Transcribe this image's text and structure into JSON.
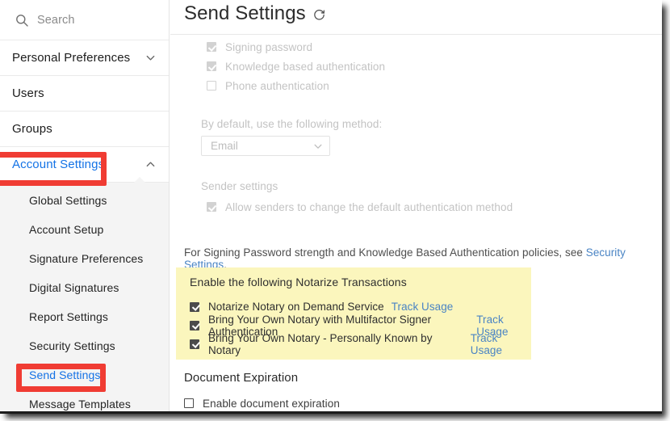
{
  "window": {
    "accent_blue": "#1473e6",
    "link_blue": "#4a84c4",
    "highlight_yellow": "#fbf6bd",
    "annotation_red": "#f03c33"
  },
  "sidebar": {
    "search": {
      "placeholder": "Search",
      "icon": "search-icon"
    },
    "nav": [
      {
        "label": "Personal Preferences",
        "icon": "chevron-down-icon",
        "expanded": false,
        "selected": false
      },
      {
        "label": "Users",
        "icon": "",
        "expanded": false,
        "selected": false
      },
      {
        "label": "Groups",
        "icon": "",
        "expanded": false,
        "selected": false
      },
      {
        "label": "Account Settings",
        "icon": "chevron-up-icon",
        "expanded": true,
        "selected": true
      }
    ],
    "submenu": [
      {
        "label": "Global Settings",
        "active": false
      },
      {
        "label": "Account Setup",
        "active": false
      },
      {
        "label": "Signature Preferences",
        "active": false
      },
      {
        "label": "Digital Signatures",
        "active": false
      },
      {
        "label": "Report Settings",
        "active": false
      },
      {
        "label": "Security Settings",
        "active": false
      },
      {
        "label": "Send Settings",
        "active": true
      },
      {
        "label": "Message Templates",
        "active": false
      }
    ]
  },
  "main": {
    "title": "Send Settings",
    "title_icon": "refresh-icon",
    "auth_methods": [
      {
        "label": "Signing password",
        "checked": true,
        "disabled": true
      },
      {
        "label": "Knowledge based authentication",
        "checked": true,
        "disabled": true
      },
      {
        "label": "Phone authentication",
        "checked": false,
        "disabled": true
      }
    ],
    "default_method": {
      "label": "By default, use the following method:",
      "value": "Email"
    },
    "sender_settings": {
      "label": "Sender settings",
      "option": {
        "label": "Allow senders to change the default authentication method",
        "checked": true,
        "disabled": true
      }
    },
    "policy_note": {
      "text": "For Signing Password strength and Knowledge Based Authentication policies, see ",
      "link": "Security Settings",
      "suffix": "."
    },
    "notarize": {
      "title": "Enable the following Notarize Transactions",
      "items": [
        {
          "label": "Notarize Notary on Demand Service",
          "checked": true,
          "link": "Track Usage"
        },
        {
          "label": "Bring Your Own Notary with Multifactor Signer Authentication",
          "checked": true,
          "link": "Track Usage"
        },
        {
          "label": "Bring Your Own Notary - Personally Known by Notary",
          "checked": true,
          "link": "Track Usage"
        }
      ]
    },
    "document_expiration": {
      "title": "Document Expiration",
      "option": {
        "label": "Enable document expiration",
        "checked": false
      }
    }
  }
}
